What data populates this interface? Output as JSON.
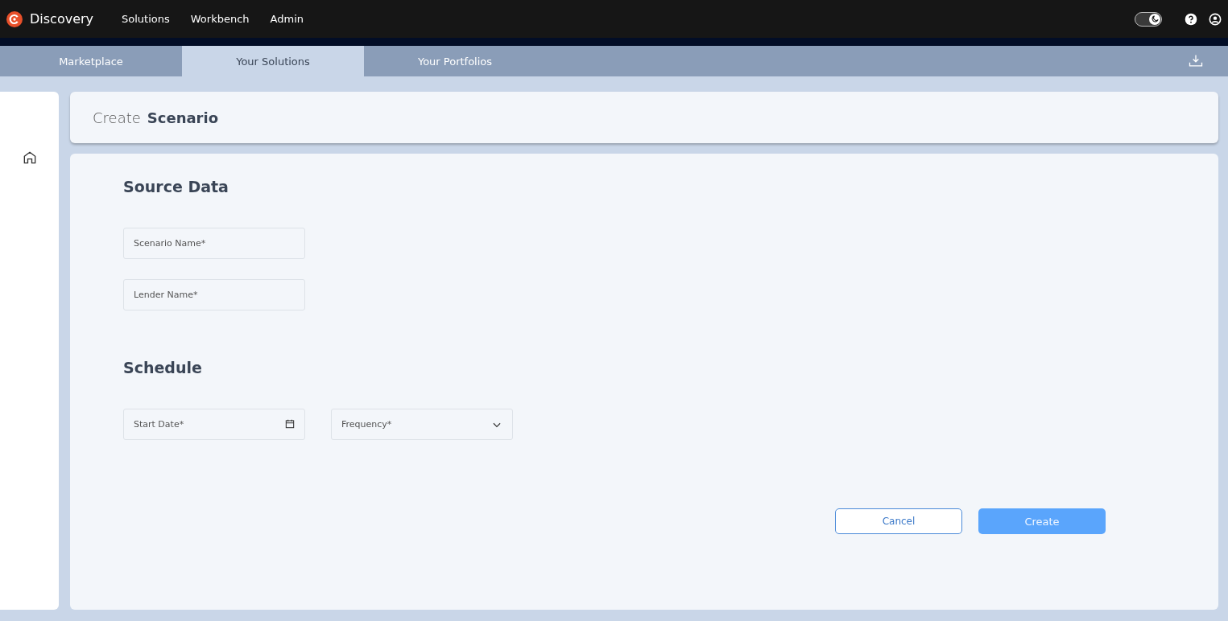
{
  "app": {
    "name": "Discovery"
  },
  "nav": [
    {
      "label": "Solutions"
    },
    {
      "label": "Workbench"
    },
    {
      "label": "Admin"
    }
  ],
  "theme_toggle": {
    "on": true
  },
  "tabs": [
    {
      "label": "Marketplace",
      "selected": false
    },
    {
      "label": "Your Solutions",
      "selected": true
    },
    {
      "label": "Your Portfolios",
      "selected": false
    }
  ],
  "page_title": {
    "prefix": "Create",
    "title": "Scenario"
  },
  "sections": [
    {
      "heading": "Source Data",
      "rows": [
        [
          {
            "kind": "text",
            "placeholder": "Scenario Name*"
          }
        ],
        [
          {
            "kind": "text",
            "placeholder": "Lender Name*"
          }
        ]
      ]
    },
    {
      "heading": "Schedule",
      "rows": [
        [
          {
            "kind": "date",
            "placeholder": "Start Date*"
          },
          {
            "kind": "select",
            "placeholder": "Frequency*"
          }
        ]
      ]
    }
  ],
  "buttons": [
    {
      "label": "Cancel",
      "kind": "secondary"
    },
    {
      "label": "Create",
      "kind": "primary"
    }
  ]
}
